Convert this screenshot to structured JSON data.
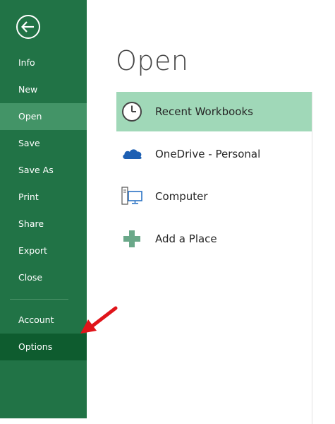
{
  "sidebar": {
    "back_icon": "back-arrow-icon",
    "items": [
      {
        "label": "Info"
      },
      {
        "label": "New"
      },
      {
        "label": "Open",
        "active": true
      },
      {
        "label": "Save"
      },
      {
        "label": "Save As"
      },
      {
        "label": "Print"
      },
      {
        "label": "Share"
      },
      {
        "label": "Export"
      },
      {
        "label": "Close"
      }
    ],
    "bottom_items": [
      {
        "label": "Account"
      },
      {
        "label": "Options",
        "highlighted": true
      }
    ],
    "colors": {
      "background": "#217346",
      "active": "#439467",
      "highlight": "#0e5c2f"
    }
  },
  "main": {
    "heading": "Open",
    "places": [
      {
        "label": "Recent Workbooks",
        "icon": "clock-icon",
        "selected": true
      },
      {
        "label": "OneDrive - Personal",
        "icon": "cloud-icon"
      },
      {
        "label": "Computer",
        "icon": "computer-icon"
      },
      {
        "label": "Add a Place",
        "icon": "plus-icon"
      }
    ],
    "selected_color": "#a0d8b8"
  },
  "annotation": {
    "icon": "red-arrow-icon",
    "color": "#e0141a"
  }
}
